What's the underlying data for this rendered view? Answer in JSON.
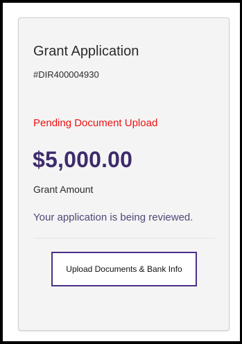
{
  "card": {
    "title": "Grant Application",
    "reference": "#DIR400004930",
    "status": "Pending Document Upload",
    "amount": "$5,000.00",
    "amount_label": "Grant Amount",
    "message": "Your application is being reviewed.",
    "button_label": "Upload Documents & Bank Info"
  },
  "colors": {
    "status": "#ee1111",
    "amount": "#3d2b6b",
    "message": "#4e4678",
    "button_border": "#4b2f86",
    "card_background": "#f4f4f4"
  }
}
